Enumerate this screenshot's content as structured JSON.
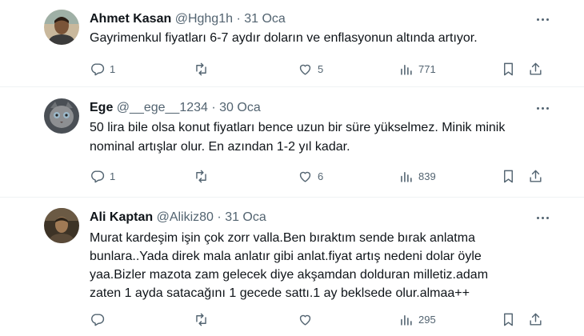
{
  "tweets": [
    {
      "name": "Ahmet Kasan",
      "handle": "@Hghg1h",
      "separator": "·",
      "date": "31 Oca",
      "text": [
        "Gayrimenkul fiyatları 6-7 aydır doların ve enflasyonun altında artıyor."
      ],
      "replies": "1",
      "retweets": "",
      "likes": "5",
      "views": "771",
      "avatar_colors": {
        "bg": "#c9b89c",
        "face": "#7a5438",
        "shirt": "#3b3b3b"
      }
    },
    {
      "name": "Ege",
      "handle": "@__ege__1234",
      "separator": "·",
      "date": "30 Oca",
      "text": [
        "50 lira bile olsa konut fiyatları bence uzun bir süre yükselmez. Minik minik",
        "nominal artışlar olur. En azından 1-2 yıl kadar."
      ],
      "replies": "1",
      "retweets": "",
      "likes": "6",
      "views": "839",
      "avatar_colors": {
        "bg": "#4a4f55",
        "face": "#8d8f92",
        "shirt": "#2b2e31"
      }
    },
    {
      "name": "Ali Kaptan",
      "handle": "@Alikiz80",
      "separator": "·",
      "date": "31 Oca",
      "text": [
        "Murat kardeşim işin çok zorr valla.Ben bıraktım sende bırak anlatma",
        "bunlara..Yada direk mala anlatır gibi anlat.fiyat artış nedeni dolar öyle",
        "yaa.Bizler mazota zam gelecek diye akşamdan dolduran milletiz.adam",
        "zaten 1 ayda satacağını 1 gecede sattı.1 ay beklsede olur.almaa++"
      ],
      "replies": "",
      "retweets": "",
      "likes": "",
      "views": "295",
      "avatar_colors": {
        "bg": "#3d3326",
        "face": "#a07a55",
        "shirt": "#5a4a38"
      }
    }
  ],
  "colors": {
    "text": "#0f1419",
    "muted": "#536471",
    "divider": "#eff3f4"
  }
}
